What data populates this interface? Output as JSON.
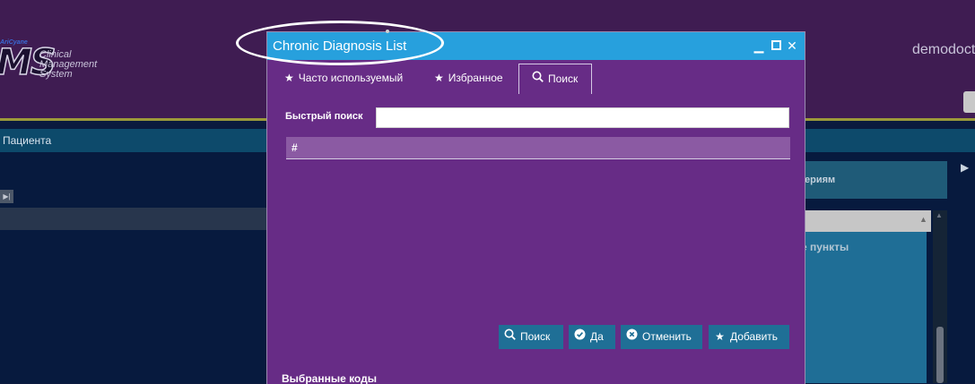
{
  "app": {
    "logo_small": "AriCyane",
    "logo_ms": "MS",
    "logo_line1": "Clinical",
    "logo_line2": "Management",
    "logo_line3": "System",
    "user_name": "demodoct"
  },
  "patient_bar": {
    "label": "Пациента"
  },
  "right_panel": {
    "card_text": "ериям",
    "list_text": "е пункты"
  },
  "modal": {
    "title": "Chronic Diagnosis List",
    "tabs": [
      {
        "label": "Часто используемый",
        "icon": "star-icon"
      },
      {
        "label": "Избранное",
        "icon": "star-icon"
      },
      {
        "label": "Поиск",
        "icon": "search-icon"
      }
    ],
    "active_tab": "Поиск",
    "quick_search": {
      "label": "Быстрый поиск",
      "value": "",
      "placeholder": ""
    },
    "grid": {
      "column_header": "#"
    },
    "buttons": {
      "search": "Поиск",
      "ok": "Да",
      "cancel": "Отменить",
      "add": "Добавить"
    },
    "selected_codes_label": "Выбранные коды"
  },
  "colors": {
    "header_bg": "#3f1c52",
    "modal_bg": "#672c86",
    "titlebar": "#27a0dd",
    "action_button": "#1f6f96",
    "grid_header": "#8b5aa3"
  }
}
